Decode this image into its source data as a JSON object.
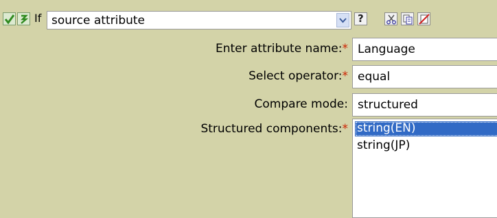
{
  "toolbar": {
    "if_label": "If",
    "condition_select": "source attribute",
    "help_label": "?"
  },
  "form": {
    "attribute_label": "Enter attribute name:",
    "attribute_value": "Language",
    "operator_label": "Select operator:",
    "operator_value": "equal",
    "mode_label": "Compare mode:",
    "mode_value": "structured",
    "components_label": "Structured components:",
    "required_marker": "*",
    "components": [
      {
        "label": "string(EN)",
        "selected": true
      },
      {
        "label": "string(JP)",
        "selected": false
      }
    ]
  },
  "colors": {
    "panel_background": "#d3d3a8",
    "selection": "#316ac5",
    "required": "#cc2200"
  },
  "icons": [
    "check-icon",
    "toggle-icon",
    "dropdown-arrow-icon",
    "help-icon",
    "cut-icon",
    "copy-icon",
    "delete-icon"
  ]
}
